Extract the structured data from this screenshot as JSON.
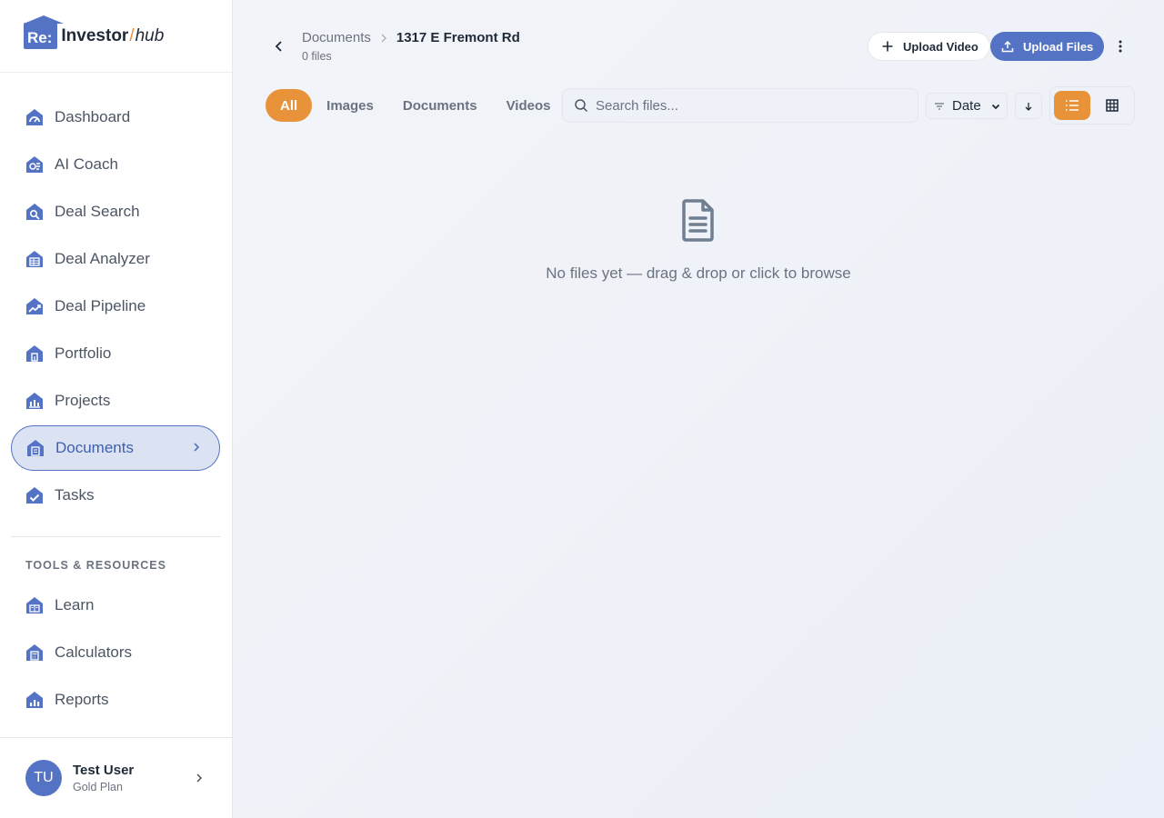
{
  "brand": {
    "re": "Re:",
    "investor": "Investor",
    "slash": "/",
    "hub": "hub"
  },
  "colors": {
    "brand_blue": "#5473c4",
    "accent_orange": "#e8923a"
  },
  "sidebar": {
    "items": [
      {
        "label": "Dashboard",
        "icon": "dashboard-icon"
      },
      {
        "label": "AI Coach",
        "icon": "ai-coach-icon"
      },
      {
        "label": "Deal Search",
        "icon": "deal-search-icon"
      },
      {
        "label": "Deal Analyzer",
        "icon": "deal-analyzer-icon"
      },
      {
        "label": "Deal Pipeline",
        "icon": "deal-pipeline-icon"
      },
      {
        "label": "Portfolio",
        "icon": "portfolio-icon"
      },
      {
        "label": "Projects",
        "icon": "projects-icon"
      },
      {
        "label": "Documents",
        "icon": "documents-icon",
        "active": true
      },
      {
        "label": "Tasks",
        "icon": "tasks-icon"
      }
    ],
    "section_title": "TOOLS & RESOURCES",
    "tools": [
      {
        "label": "Learn",
        "icon": "learn-icon"
      },
      {
        "label": "Calculators",
        "icon": "calculators-icon"
      },
      {
        "label": "Reports",
        "icon": "reports-icon"
      }
    ],
    "user": {
      "initials": "TU",
      "name": "Test User",
      "plan": "Gold Plan"
    }
  },
  "header": {
    "breadcrumb_parent": "Documents",
    "breadcrumb_current": "1317 E Fremont Rd",
    "file_count": "0 files",
    "upload_video_label": "Upload Video",
    "upload_files_label": "Upload Files"
  },
  "filters": {
    "tabs": [
      {
        "label": "All",
        "active": true
      },
      {
        "label": "Images"
      },
      {
        "label": "Documents"
      },
      {
        "label": "Videos"
      }
    ],
    "search_placeholder": "Search files...",
    "sort_label": "Date"
  },
  "empty_state": {
    "message": "No files yet — drag & drop or click to browse"
  }
}
